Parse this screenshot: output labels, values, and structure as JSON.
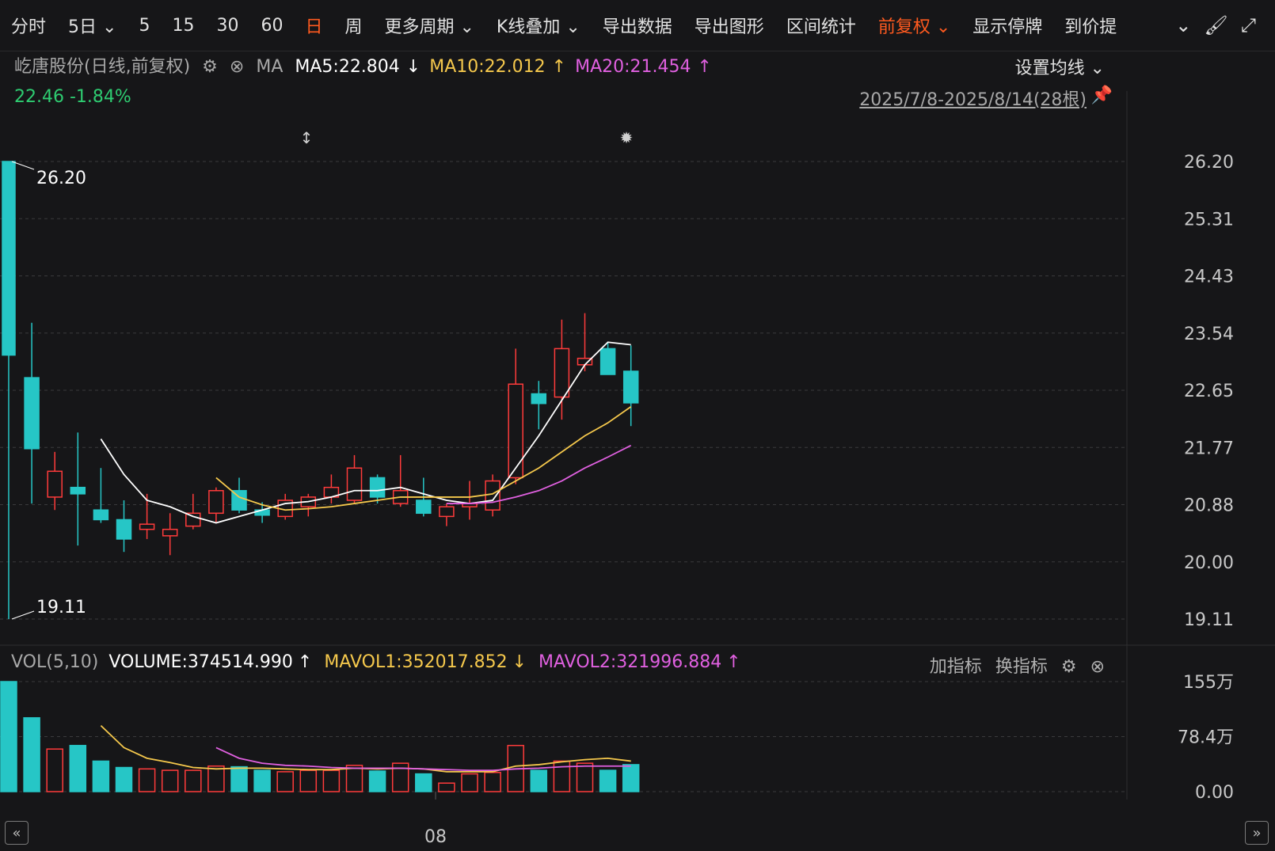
{
  "toolbar": {
    "items": [
      {
        "label": "分时"
      },
      {
        "label": "5日 ⌄"
      },
      {
        "label": "5"
      },
      {
        "label": "15"
      },
      {
        "label": "30"
      },
      {
        "label": "60"
      },
      {
        "label": "日"
      },
      {
        "label": "周"
      },
      {
        "label": "更多周期 ⌄"
      },
      {
        "label": "K线叠加 ⌄"
      },
      {
        "label": "导出数据"
      },
      {
        "label": "导出图形"
      },
      {
        "label": "区间统计"
      },
      {
        "label": "前复权 ⌄"
      },
      {
        "label": "显示停牌"
      },
      {
        "label": "到价提"
      }
    ],
    "active_index": 6,
    "icons": [
      "chevron-circle-icon",
      "brush-icon",
      "fullscreen-icon"
    ]
  },
  "info": {
    "stock": "屹唐股份(日线,前复权)",
    "ma_label": "MA",
    "ma5": "MA5:22.804",
    "ma5_arrow": "↓",
    "ma10": "MA10:22.012",
    "ma10_arrow": "↑",
    "ma20": "MA20:21.454",
    "ma20_arrow": "↑",
    "price": "22.46",
    "change": "-1.84%",
    "ma_settings": "设置均线 ⌄",
    "range": "2025/7/8-2025/8/14(28根)"
  },
  "volume_header": {
    "label": "VOL(5,10)",
    "volume": "VOLUME:374514.990",
    "volume_arrow": "↑",
    "mavol1": "MAVOL1:352017.852",
    "mavol1_arrow": "↓",
    "mavol2": "MAVOL2:321996.884",
    "mavol2_arrow": "↑",
    "add_indicator": "加指标",
    "switch_indicator": "换指标"
  },
  "colors": {
    "up": "#ff3b3b",
    "down": "#26c6c6",
    "ma5": "#ffffff",
    "ma10": "#f5c84c",
    "ma20": "#e060e0",
    "text_green": "#2ecc71",
    "accent": "#ff5a1f"
  },
  "chart_data": {
    "type": "candlestick",
    "price_ticks": [
      "26.20",
      "25.31",
      "24.43",
      "23.54",
      "22.65",
      "21.77",
      "20.88",
      "20.00",
      "19.11"
    ],
    "price_range": [
      19.11,
      26.2
    ],
    "high_label": "26.20",
    "low_label": "19.11",
    "x_tick": "08",
    "volume_ticks": [
      "155万",
      "78.4万",
      "0.00"
    ],
    "volume_range": [
      0,
      155
    ],
    "candles": [
      {
        "o": 26.2,
        "c": 23.2,
        "h": 26.2,
        "l": 19.11,
        "v": 155
      },
      {
        "o": 22.85,
        "c": 21.75,
        "h": 23.7,
        "l": 20.9,
        "v": 104
      },
      {
        "o": 21.0,
        "c": 21.4,
        "h": 21.7,
        "l": 20.8,
        "v": 60
      },
      {
        "o": 21.15,
        "c": 21.05,
        "h": 22.0,
        "l": 20.25,
        "v": 65
      },
      {
        "o": 20.8,
        "c": 20.65,
        "h": 21.45,
        "l": 20.6,
        "v": 43
      },
      {
        "o": 20.65,
        "c": 20.35,
        "h": 20.95,
        "l": 20.15,
        "v": 34
      },
      {
        "o": 20.5,
        "c": 20.58,
        "h": 21.05,
        "l": 20.35,
        "v": 32
      },
      {
        "o": 20.4,
        "c": 20.5,
        "h": 20.75,
        "l": 20.1,
        "v": 30
      },
      {
        "o": 20.55,
        "c": 20.75,
        "h": 21.05,
        "l": 20.5,
        "v": 30
      },
      {
        "o": 20.75,
        "c": 21.1,
        "h": 21.15,
        "l": 20.6,
        "v": 36
      },
      {
        "o": 21.1,
        "c": 20.8,
        "h": 21.3,
        "l": 20.75,
        "v": 35
      },
      {
        "o": 20.8,
        "c": 20.72,
        "h": 20.92,
        "l": 20.6,
        "v": 30
      },
      {
        "o": 20.7,
        "c": 20.95,
        "h": 21.05,
        "l": 20.65,
        "v": 28
      },
      {
        "o": 20.85,
        "c": 21.0,
        "h": 21.05,
        "l": 20.7,
        "v": 30
      },
      {
        "o": 21.0,
        "c": 21.15,
        "h": 21.35,
        "l": 20.9,
        "v": 30
      },
      {
        "o": 20.95,
        "c": 21.45,
        "h": 21.65,
        "l": 20.9,
        "v": 37
      },
      {
        "o": 21.3,
        "c": 21.0,
        "h": 21.35,
        "l": 20.9,
        "v": 29
      },
      {
        "o": 20.9,
        "c": 21.1,
        "h": 21.65,
        "l": 20.85,
        "v": 40
      },
      {
        "o": 20.95,
        "c": 20.75,
        "h": 21.3,
        "l": 20.7,
        "v": 25
      },
      {
        "o": 20.7,
        "c": 20.85,
        "h": 20.9,
        "l": 20.55,
        "v": 12
      },
      {
        "o": 20.85,
        "c": 20.9,
        "h": 21.25,
        "l": 20.65,
        "v": 25
      },
      {
        "o": 20.8,
        "c": 21.25,
        "h": 21.35,
        "l": 20.7,
        "v": 27
      },
      {
        "o": 21.3,
        "c": 22.75,
        "h": 23.3,
        "l": 21.2,
        "v": 65
      },
      {
        "o": 22.6,
        "c": 22.45,
        "h": 22.8,
        "l": 22.05,
        "v": 30
      },
      {
        "o": 22.55,
        "c": 23.3,
        "h": 23.75,
        "l": 22.2,
        "v": 43
      },
      {
        "o": 23.05,
        "c": 23.15,
        "h": 23.85,
        "l": 22.95,
        "v": 40
      },
      {
        "o": 23.3,
        "c": 22.9,
        "h": 23.4,
        "l": 22.9,
        "v": 30
      },
      {
        "o": 22.95,
        "c": 22.46,
        "h": 23.35,
        "l": 22.1,
        "v": 38
      }
    ],
    "ma5": [
      null,
      null,
      null,
      null,
      21.9,
      21.35,
      20.95,
      20.85,
      20.7,
      20.6,
      20.7,
      20.8,
      20.9,
      20.93,
      21.0,
      21.1,
      21.1,
      21.15,
      21.05,
      20.95,
      20.9,
      20.95,
      21.45,
      21.95,
      22.5,
      23.05,
      23.4,
      23.36
    ],
    "ma10": [
      null,
      null,
      null,
      null,
      null,
      null,
      null,
      null,
      null,
      21.3,
      21.0,
      20.88,
      20.8,
      20.82,
      20.85,
      20.9,
      20.95,
      21.0,
      21.0,
      21.0,
      21.0,
      21.05,
      21.25,
      21.45,
      21.7,
      21.95,
      22.15,
      22.4
    ],
    "ma20": [
      null,
      null,
      null,
      null,
      null,
      null,
      null,
      null,
      null,
      null,
      null,
      null,
      null,
      null,
      null,
      null,
      null,
      null,
      null,
      20.9,
      20.9,
      20.92,
      21.0,
      21.1,
      21.25,
      21.45,
      21.62,
      21.8
    ],
    "mavol1": [
      null,
      null,
      null,
      null,
      93,
      62,
      47,
      41,
      34,
      32,
      33,
      33,
      32,
      31,
      31,
      33,
      32,
      33,
      32,
      28,
      28,
      28,
      36,
      38,
      42,
      45,
      47,
      43
    ],
    "mavol2": [
      null,
      null,
      null,
      null,
      null,
      null,
      null,
      null,
      null,
      62,
      47,
      40,
      37,
      36,
      34,
      33,
      33,
      33,
      32,
      31,
      30,
      30,
      32,
      33,
      35,
      36,
      36,
      36
    ]
  }
}
